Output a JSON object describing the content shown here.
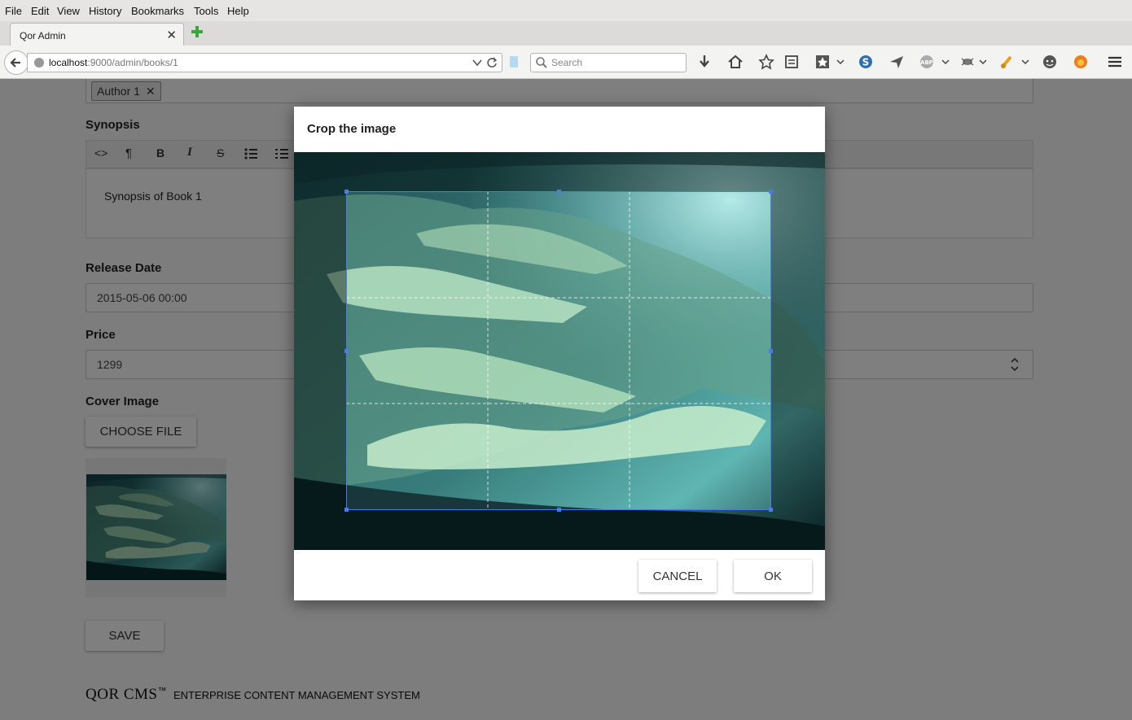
{
  "browser": {
    "menu": [
      "File",
      "Edit",
      "View",
      "History",
      "Bookmarks",
      "Tools",
      "Help"
    ],
    "tab_title": "Qor Admin",
    "url_host": "localhost",
    "url_rest": ":9000/admin/books/1",
    "search_placeholder": "Search"
  },
  "form": {
    "author_tag": "Author 1",
    "synopsis_label": "Synopsis",
    "synopsis_text": "Synopsis of Book 1",
    "release_date_label": "Release Date",
    "release_date_value": "2015-05-06 00:00",
    "price_label": "Price",
    "price_value": "1299",
    "cover_image_label": "Cover Image",
    "choose_file_label": "CHOOSE FILE",
    "save_label": "SAVE"
  },
  "footer": {
    "brand": "QOR CMS",
    "tm": "™",
    "tagline": "ENTERPRISE CONTENT MANAGEMENT SYSTEM"
  },
  "dialog": {
    "title": "Crop the image",
    "cancel_label": "CANCEL",
    "ok_label": "OK"
  },
  "colors": {
    "crop_border": "#4a7be8",
    "overlay": "rgba(0,0,0,0.5)"
  }
}
